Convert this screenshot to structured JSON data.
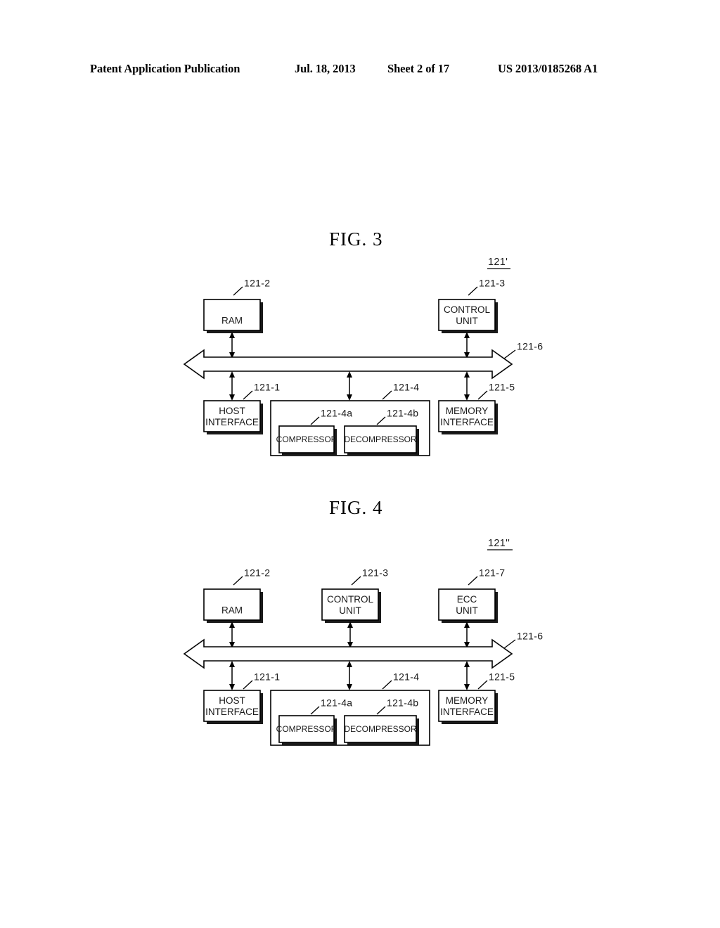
{
  "header": {
    "publication": "Patent Application Publication",
    "date": "Jul. 18, 2013",
    "sheet": "Sheet 2 of 17",
    "patent_number": "US 2013/0185268 A1"
  },
  "figures": [
    {
      "title": "FIG.  3",
      "assembly_ref": "121'",
      "bus_ref": "121-6",
      "top_blocks": [
        {
          "label": "RAM",
          "ref": "121-2"
        },
        {
          "label": "CONTROL UNIT",
          "ref": "121-3"
        }
      ],
      "bottom_blocks": [
        {
          "label": "HOST INTERFACE",
          "ref": "121-1"
        },
        {
          "label": "MEMORY INTERFACE",
          "ref": "121-5"
        }
      ],
      "codec_block": {
        "ref": "121-4",
        "children": [
          {
            "label": "COMPRESSOR",
            "ref": "121-4a"
          },
          {
            "label": "DECOMPRESSOR",
            "ref": "121-4b"
          }
        ]
      }
    },
    {
      "title": "FIG.  4",
      "assembly_ref": "121''",
      "bus_ref": "121-6",
      "top_blocks": [
        {
          "label": "RAM",
          "ref": "121-2"
        },
        {
          "label": "CONTROL UNIT",
          "ref": "121-3"
        },
        {
          "label": "ECC UNIT",
          "ref": "121-7"
        }
      ],
      "bottom_blocks": [
        {
          "label": "HOST INTERFACE",
          "ref": "121-1"
        },
        {
          "label": "MEMORY INTERFACE",
          "ref": "121-5"
        }
      ],
      "codec_block": {
        "ref": "121-4",
        "children": [
          {
            "label": "COMPRESSOR",
            "ref": "121-4a"
          },
          {
            "label": "DECOMPRESSOR",
            "ref": "121-4b"
          }
        ]
      }
    }
  ]
}
